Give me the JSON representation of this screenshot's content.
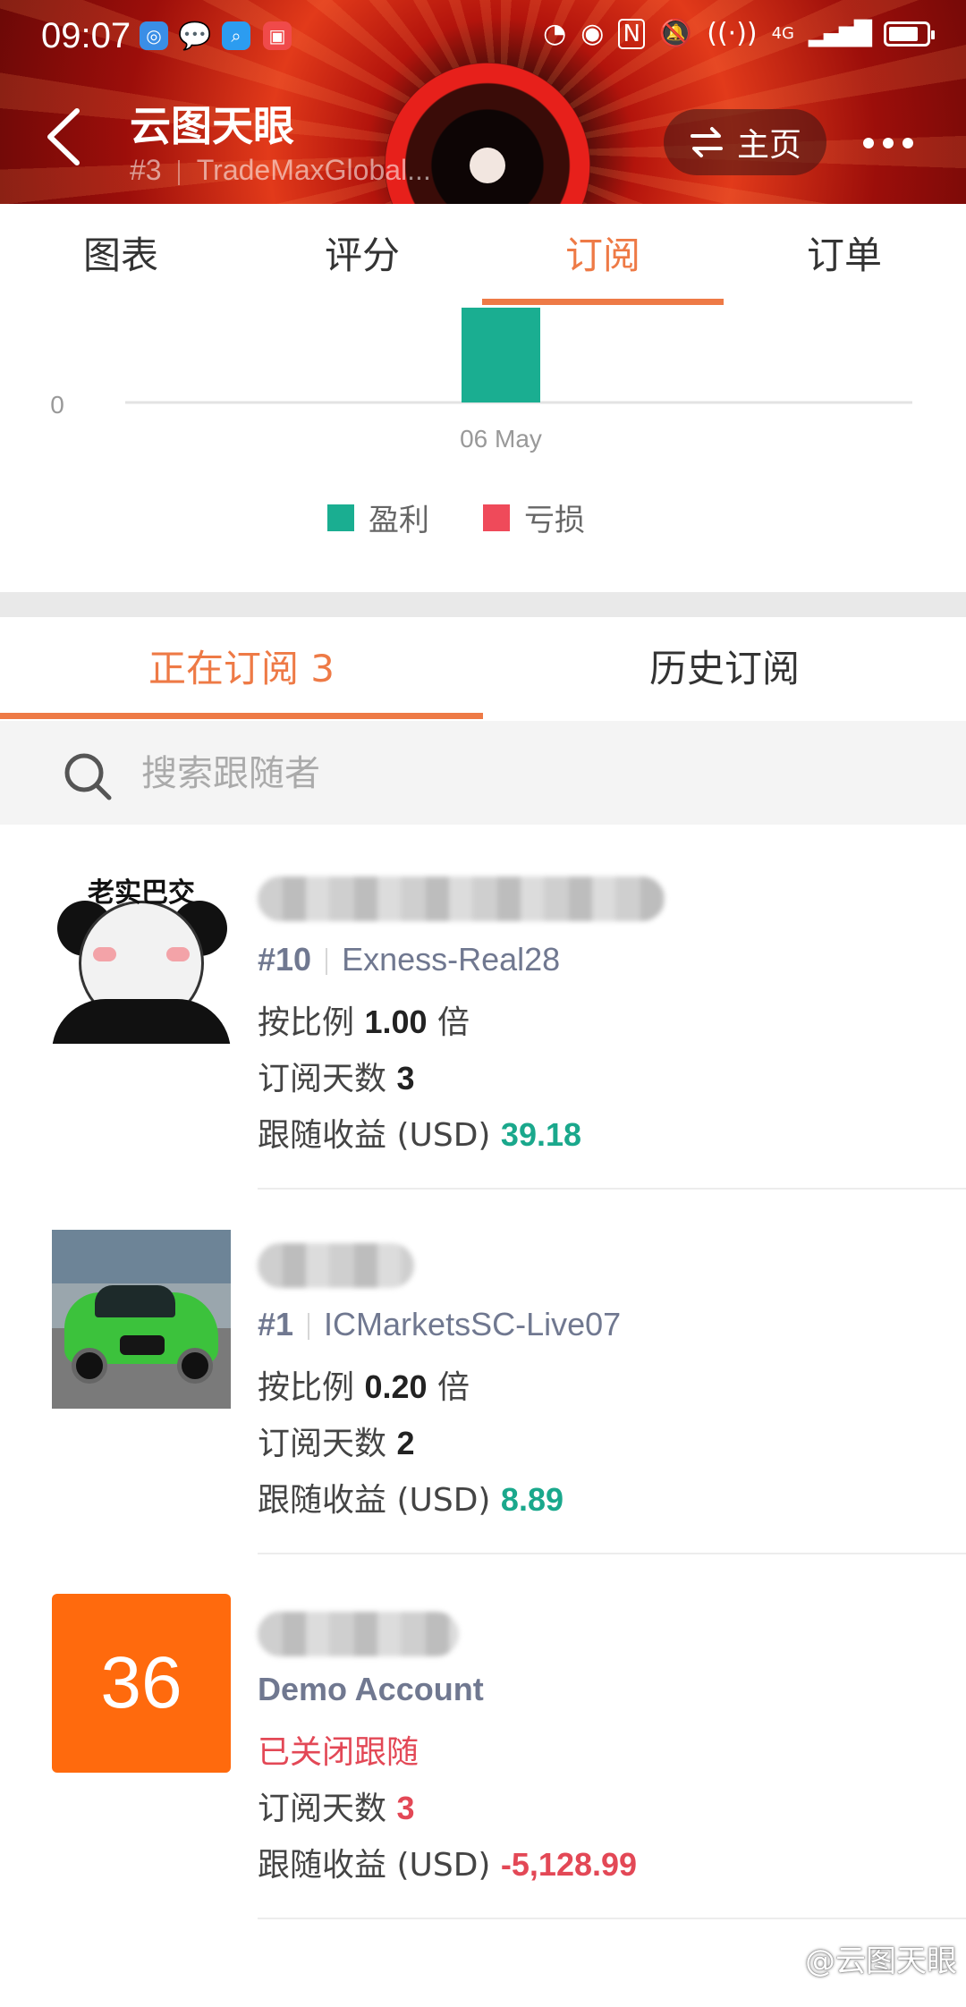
{
  "status_bar": {
    "time": "09:07",
    "network": "4G",
    "app_icons": [
      "browser-icon",
      "chat-icon",
      "search-app-icon",
      "gallery-icon"
    ]
  },
  "nav": {
    "title": "云图天眼",
    "subtitle_rank": "#3",
    "subtitle_name": "TradeMaxGlobal...",
    "home_label": "主页"
  },
  "tabs": [
    {
      "label": "图表"
    },
    {
      "label": "评分"
    },
    {
      "label": "订阅",
      "active": true
    },
    {
      "label": "订单"
    }
  ],
  "chart_data": {
    "type": "bar",
    "categories": [
      "06 May"
    ],
    "series": [
      {
        "name": "盈利",
        "color": "#1aae91",
        "values": [
          1
        ]
      },
      {
        "name": "亏损",
        "color": "#ef4a5a",
        "values": [
          0
        ]
      }
    ],
    "y_tick_labels": [
      "0"
    ],
    "legend_position": "bottom"
  },
  "subscription_tabs": {
    "current_label": "正在订阅 3",
    "history_label": "历史订阅"
  },
  "search": {
    "placeholder": "搜索跟随者"
  },
  "followers": [
    {
      "avatar_caption": "老实巴交",
      "rank": "#10",
      "server": "Exness-Real28",
      "ratio_prefix": "按比例",
      "ratio_value": "1.00",
      "ratio_suffix": "倍",
      "days_label": "订阅天数",
      "days_value": "3",
      "profit_label": "跟随收益 (USD)",
      "profit_value": "39.18"
    },
    {
      "rank": "#1",
      "server": "ICMarketsSC-Live07",
      "ratio_prefix": "按比例",
      "ratio_value": "0.20",
      "ratio_suffix": "倍",
      "days_label": "订阅天数",
      "days_value": "2",
      "profit_label": "跟随收益 (USD)",
      "profit_value": "8.89"
    },
    {
      "avatar_text": "36",
      "account_type": "Demo Account",
      "status": "已关闭跟随",
      "days_label": "订阅天数",
      "days_value": "3",
      "profit_label": "跟随收益 (USD)",
      "profit_value": "-5,128.99"
    }
  ],
  "watermark": "@云图天眼",
  "colors": {
    "accent": "#ee7a46",
    "profit": "#1aa88c",
    "loss": "#e34856"
  }
}
